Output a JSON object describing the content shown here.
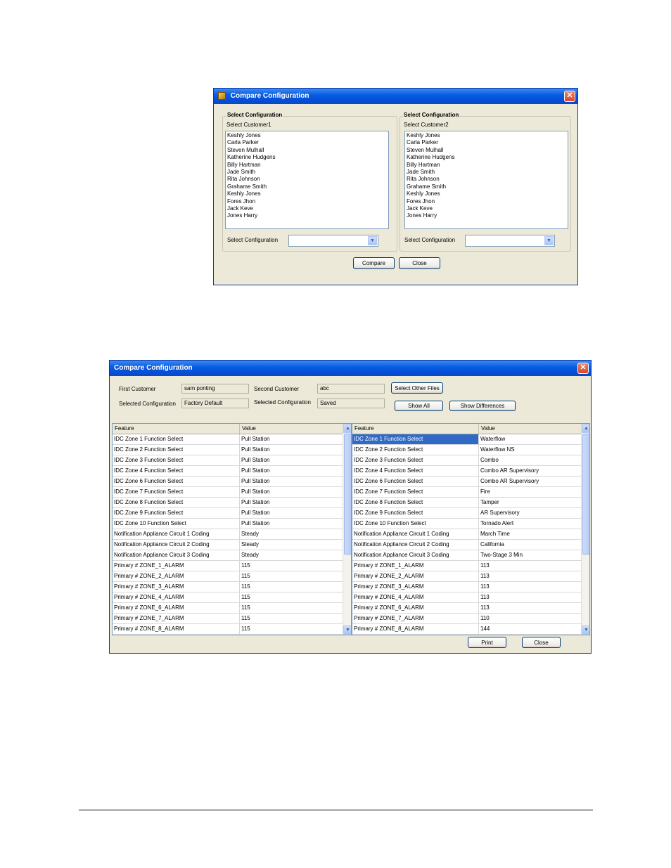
{
  "dialog1": {
    "title": "Compare Configuration",
    "close_glyph": "✕",
    "left": {
      "group_title": "Select Configuration",
      "customer_label": "Select Customer1",
      "customers": [
        "Keshly Jones",
        "Carla Parker",
        "Steven Mulhall",
        "Katherine Hudgens",
        "Billy Hartman",
        "Jade Smith",
        "Rita Johnson",
        "Grahame Smith",
        "Keshly Jones",
        "Fores Jhon",
        "Jack Keve",
        "Jones Harry"
      ],
      "config_label": "Select Configuration",
      "config_value": ""
    },
    "right": {
      "group_title": "Select Configuration",
      "customer_label": "Select Customer2",
      "customers": [
        "Keshly Jones",
        "Carla Parker",
        "Steven Mulhall",
        "Katherine Hudgens",
        "Billy Hartman",
        "Jade Smith",
        "Rita Johnson",
        "Grahame Smith",
        "Keshly Jones",
        "Fores Jhon",
        "Jack Keve",
        "Jones Harry"
      ],
      "config_label": "Select Configuration",
      "config_value": ""
    },
    "compare_label": "Compare",
    "close_label": "Close"
  },
  "dialog2": {
    "title": "Compare Configuration",
    "close_glyph": "✕",
    "first_customer_label": "First Customer",
    "first_customer_value": "sam ponting",
    "second_customer_label": "Second Customer",
    "second_customer_value": "abc",
    "select_other_files_label": "Select Other Files",
    "selected_config_label_1": "Selected Configuration",
    "selected_config_value_1": "Factory Default",
    "selected_config_label_2": "Selected Configuration",
    "selected_config_value_2": "Saved",
    "show_all_label": "Show All",
    "show_differences_label": "Show Differences",
    "left_grid": {
      "headers": [
        "Feature",
        "Value"
      ],
      "rows": [
        [
          "IDC Zone 1 Function Select",
          "Pull Station"
        ],
        [
          "IDC Zone 2 Function Select",
          "Pull Station"
        ],
        [
          "IDC Zone 3 Function Select",
          "Pull Station"
        ],
        [
          "IDC Zone 4 Function Select",
          "Pull Station"
        ],
        [
          "IDC Zone 6 Function Select",
          "Pull Station"
        ],
        [
          "IDC Zone 7 Function Select",
          "Pull Station"
        ],
        [
          "IDC Zone 8 Function Select",
          "Pull Station"
        ],
        [
          "IDC Zone 9 Function Select",
          "Pull Station"
        ],
        [
          "IDC Zone 10 Function Select",
          "Pull Station"
        ],
        [
          "Notification Appliance Circuit 1 Coding",
          "Steady"
        ],
        [
          "Notification Appliance Circuit 2 Coding",
          "Steady"
        ],
        [
          "Notification Appliance Circuit 3 Coding",
          "Steady"
        ],
        [
          "Primary # ZONE_1_ALARM",
          "115"
        ],
        [
          "Primary # ZONE_2_ALARM",
          "115"
        ],
        [
          "Primary # ZONE_3_ALARM",
          "115"
        ],
        [
          "Primary # ZONE_4_ALARM",
          "115"
        ],
        [
          "Primary # ZONE_6_ALARM",
          "115"
        ],
        [
          "Primary # ZONE_7_ALARM",
          "115"
        ],
        [
          "Primary # ZONE_8_ALARM",
          "115"
        ]
      ]
    },
    "right_grid": {
      "headers": [
        "Feature",
        "Value"
      ],
      "selected_row": 0,
      "rows": [
        [
          "IDC Zone 1 Function Select",
          "Waterflow"
        ],
        [
          "IDC Zone 2 Function Select",
          "Waterflow NS"
        ],
        [
          "IDC Zone 3 Function Select",
          "Combo"
        ],
        [
          "IDC Zone 4 Function Select",
          "Combo AR Supervisory"
        ],
        [
          "IDC Zone 6 Function Select",
          "Combo AR Supervisory"
        ],
        [
          "IDC Zone 7 Function Select",
          "Fire"
        ],
        [
          "IDC Zone 8 Function Select",
          "Tamper"
        ],
        [
          "IDC Zone 9 Function Select",
          "AR Supervisory"
        ],
        [
          "IDC Zone 10 Function Select",
          "Tornado Alert"
        ],
        [
          "Notification Appliance Circuit 1 Coding",
          "March Time"
        ],
        [
          "Notification Appliance Circuit 2 Coding",
          "California"
        ],
        [
          "Notification Appliance Circuit 3 Coding",
          "Two-Stage 3 Min"
        ],
        [
          "Primary # ZONE_1_ALARM",
          "113"
        ],
        [
          "Primary # ZONE_2_ALARM",
          "113"
        ],
        [
          "Primary # ZONE_3_ALARM",
          "113"
        ],
        [
          "Primary # ZONE_4_ALARM",
          "113"
        ],
        [
          "Primary # ZONE_6_ALARM",
          "113"
        ],
        [
          "Primary # ZONE_7_ALARM",
          "110"
        ],
        [
          "Primary # ZONE_8_ALARM",
          "144"
        ]
      ]
    },
    "print_label": "Print",
    "close_label": "Close"
  },
  "icons": {
    "scroll_up": "▲",
    "scroll_down": "▼",
    "combo_arrow": "▼",
    "grip": "≡"
  },
  "colors": {
    "titlebar": "#0a5de3",
    "window_face": "#ece9d8",
    "selection": "#316ac5",
    "close_button": "#d5462b"
  }
}
